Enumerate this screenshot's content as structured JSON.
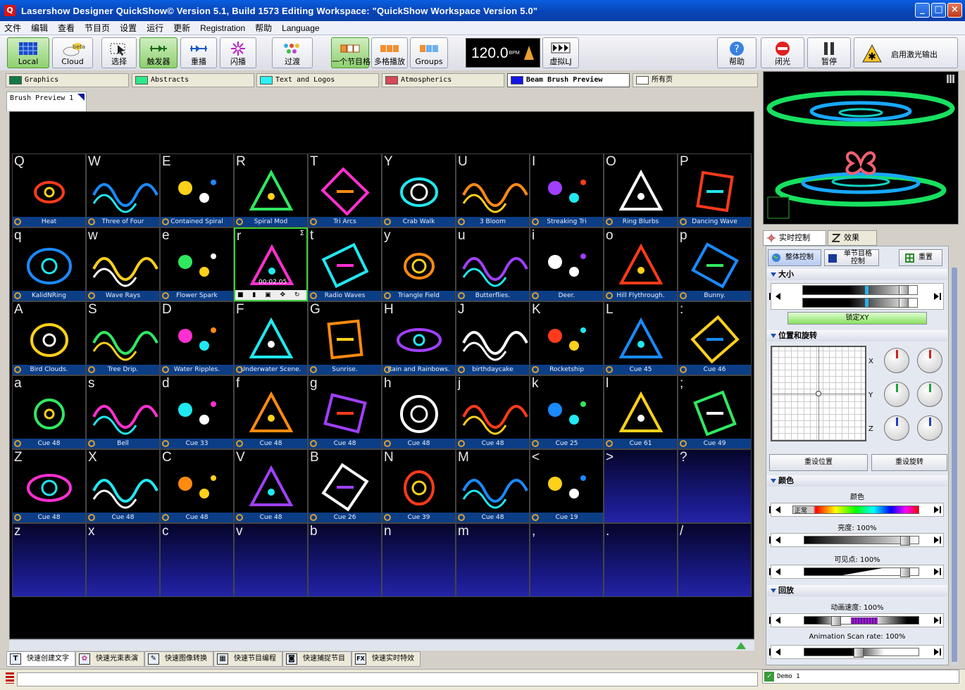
{
  "window": {
    "title": "Lasershow Designer QuickShow©   Version 5.1, Build 1573   Editing Workspace: \"QuickShow Workspace Version 5.0\""
  },
  "menu": [
    "文件",
    "编辑",
    "查看",
    "节目页",
    "设置",
    "运行",
    "更新",
    "Registration",
    "帮助",
    "Language"
  ],
  "toolbar": {
    "local": "Local",
    "cloud": "Cloud",
    "cloud_badge": "beta",
    "select": "选择",
    "trigger": "触发器",
    "repeat": "重播",
    "flash": "闪播",
    "transition": "过渡",
    "single_cue": "一个节目格",
    "multi_cue": "多格播放",
    "groups": "Groups",
    "bpm": "120.0",
    "bpm_unit": "BPM",
    "virtual_lj": "虚拟LJ",
    "help": "帮助",
    "blackout": "闭光",
    "pause": "暂停",
    "enable_laser": "启用激光输出"
  },
  "page_tabs": [
    {
      "label": "Graphics",
      "color": "#0f7a46"
    },
    {
      "label": "Abstracts",
      "color": "#2ee88a"
    },
    {
      "label": "Text and Logos",
      "color": "#2ef2f2"
    },
    {
      "label": "Atmospherics",
      "color": "#d84858"
    },
    {
      "label": "Beam Brush Preview",
      "color": "#1414e8"
    },
    {
      "label": "所有页",
      "color": "#ffffff"
    }
  ],
  "sub_tab": "Brush Preview 1",
  "grid": {
    "rows": [
      [
        {
          "key": "Q",
          "name": "Heat"
        },
        {
          "key": "W",
          "name": "Three of Four"
        },
        {
          "key": "E",
          "name": "Contained Spiral"
        },
        {
          "key": "R",
          "name": "Spiral Mod"
        },
        {
          "key": "T",
          "name": "Tri Arcs"
        },
        {
          "key": "Y",
          "name": "Crab Walk"
        },
        {
          "key": "U",
          "name": "3 Bloom"
        },
        {
          "key": "I",
          "name": "Streaking Tri"
        },
        {
          "key": "O",
          "name": "Ring Blurbs"
        },
        {
          "key": "P",
          "name": "Dancing Wave"
        }
      ],
      [
        {
          "key": "q",
          "name": "KalidNRing"
        },
        {
          "key": "w",
          "name": "Wave Rays"
        },
        {
          "key": "e",
          "name": "Flower Spark"
        },
        {
          "key": "r",
          "name": "",
          "timer": "00:02.05",
          "sigma": "Σ",
          "controls": "■ ▮ ▣ ✥ ↻ ⊕"
        },
        {
          "key": "t",
          "name": "Radio Waves"
        },
        {
          "key": "y",
          "name": "Triangle Field"
        },
        {
          "key": "u",
          "name": "Butterflies."
        },
        {
          "key": "i",
          "name": "Deer."
        },
        {
          "key": "o",
          "name": "Hill Flythrough."
        },
        {
          "key": "p",
          "name": "Bunny."
        }
      ],
      [
        {
          "key": "A",
          "name": "Bird Clouds."
        },
        {
          "key": "S",
          "name": "Tree Drip."
        },
        {
          "key": "D",
          "name": "Water Ripples."
        },
        {
          "key": "F",
          "name": "Underwater Scene."
        },
        {
          "key": "G",
          "name": "Sunrise."
        },
        {
          "key": "H",
          "name": "Rain and Rainbows."
        },
        {
          "key": "J",
          "name": "birthdaycake"
        },
        {
          "key": "K",
          "name": "Rocketship"
        },
        {
          "key": "L",
          "name": "Cue 45"
        },
        {
          "key": ":",
          "name": "Cue 46"
        }
      ],
      [
        {
          "key": "a",
          "name": "Cue 48"
        },
        {
          "key": "s",
          "name": "Bell"
        },
        {
          "key": "d",
          "name": "Cue 33"
        },
        {
          "key": "f",
          "name": "Cue 48"
        },
        {
          "key": "g",
          "name": "Cue 48"
        },
        {
          "key": "h",
          "name": "Cue 48"
        },
        {
          "key": "j",
          "name": "Cue 48"
        },
        {
          "key": "k",
          "name": "Cue 25"
        },
        {
          "key": "l",
          "name": "Cue 61"
        },
        {
          "key": ";",
          "name": "Cue 49"
        }
      ],
      [
        {
          "key": "Z",
          "name": "Cue 48"
        },
        {
          "key": "X",
          "name": "Cue 48"
        },
        {
          "key": "C",
          "name": "Cue 48"
        },
        {
          "key": "V",
          "name": "Cue 48"
        },
        {
          "key": "B",
          "name": "Cue 26"
        },
        {
          "key": "N",
          "name": "Cue 39"
        },
        {
          "key": "M",
          "name": "Cue 48"
        },
        {
          "key": "<",
          "name": "Cue 19"
        },
        {
          "key": ">",
          "name": null
        },
        {
          "key": "?",
          "name": null
        }
      ],
      [
        {
          "key": "z",
          "name": null
        },
        {
          "key": "x",
          "name": null
        },
        {
          "key": "c",
          "name": null
        },
        {
          "key": "v",
          "name": null
        },
        {
          "key": "b",
          "name": null
        },
        {
          "key": "n",
          "name": null
        },
        {
          "key": "m",
          "name": null
        },
        {
          "key": ",",
          "name": null
        },
        {
          "key": ".",
          "name": null
        },
        {
          "key": "/",
          "name": null
        }
      ]
    ]
  },
  "bottom_tabs": [
    {
      "icon": "T",
      "label": "快速创建文字"
    },
    {
      "icon": "✿",
      "label": "快速光束表演"
    },
    {
      "icon": "✎",
      "label": "快速图像转换"
    },
    {
      "icon": "▦",
      "label": "快速节目编程"
    },
    {
      "icon": "◙",
      "label": "快速捕捉节目"
    },
    {
      "icon": "FX",
      "label": "快速实时特效"
    }
  ],
  "right_panel": {
    "tabs": [
      "实时控制",
      "效果"
    ],
    "mode_buttons": [
      "整体控制",
      "单节目格\n控制",
      "重置"
    ],
    "size_section": "大小",
    "lock_xy": "锁定XY",
    "pos_section": "位置和旋转",
    "axes": [
      "X",
      "Y",
      "Z"
    ],
    "reset_pos": "重设位置",
    "reset_rot": "重设旋转",
    "color_section": "颜色",
    "color_label": "颜色",
    "color_normal": "正常",
    "brightness": "亮度: 100%",
    "visible_points": "可见点:   100%",
    "playback_section": "回放",
    "anim_speed": "动画速度:  100%",
    "scan_rate": "Animation Scan rate: 100%"
  },
  "status": {
    "zone": "Demo 1"
  }
}
